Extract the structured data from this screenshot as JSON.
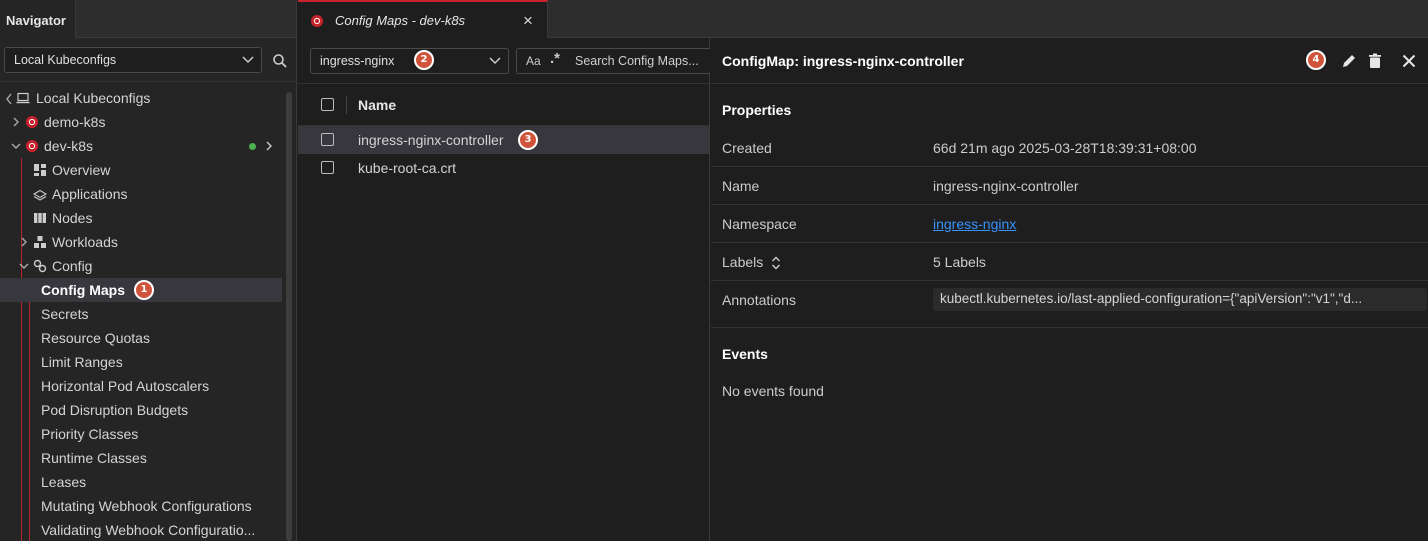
{
  "navigator": {
    "title": "Navigator",
    "kubeconfig_select": "Local Kubeconfigs",
    "tree": {
      "root": "Local Kubeconfigs",
      "cluster_1": "demo-k8s",
      "cluster_2": "dev-k8s",
      "overview": "Overview",
      "applications": "Applications",
      "nodes": "Nodes",
      "workloads": "Workloads",
      "config": "Config",
      "config_items": [
        "Config Maps",
        "Secrets",
        "Resource Quotas",
        "Limit Ranges",
        "Horizontal Pod Autoscalers",
        "Pod Disruption Budgets",
        "Priority Classes",
        "Runtime Classes",
        "Leases",
        "Mutating Webhook Configurations",
        "Validating Webhook Configuratio..."
      ]
    }
  },
  "tab": {
    "label": "Config Maps - dev-k8s",
    "close": "×"
  },
  "list": {
    "namespace_select": "ingress-nginx",
    "match_case": "Aa",
    "regex": ".*",
    "search_placeholder": "Search Config Maps...",
    "column_name": "Name",
    "rows": [
      "ingress-nginx-controller",
      "kube-root-ca.crt"
    ]
  },
  "detail": {
    "title": "ConfigMap: ingress-nginx-controller",
    "properties_heading": "Properties",
    "props": {
      "created_label": "Created",
      "created_value": "66d 21m ago 2025-03-28T18:39:31+08:00",
      "name_label": "Name",
      "name_value": "ingress-nginx-controller",
      "namespace_label": "Namespace",
      "namespace_value": "ingress-nginx",
      "labels_label": "Labels",
      "labels_value": "5 Labels",
      "annotations_label": "Annotations",
      "annotations_value": "kubectl.kubernetes.io/last-applied-configuration={\"apiVersion\":\"v1\",\"d..."
    },
    "events_heading": "Events",
    "events_empty": "No events found"
  },
  "badges": [
    "1",
    "2",
    "3",
    "4"
  ],
  "colors": {
    "accent_red": "#c8232c",
    "status_green": "#4caf50",
    "badge": "#d0543c",
    "link": "#3794ff"
  }
}
